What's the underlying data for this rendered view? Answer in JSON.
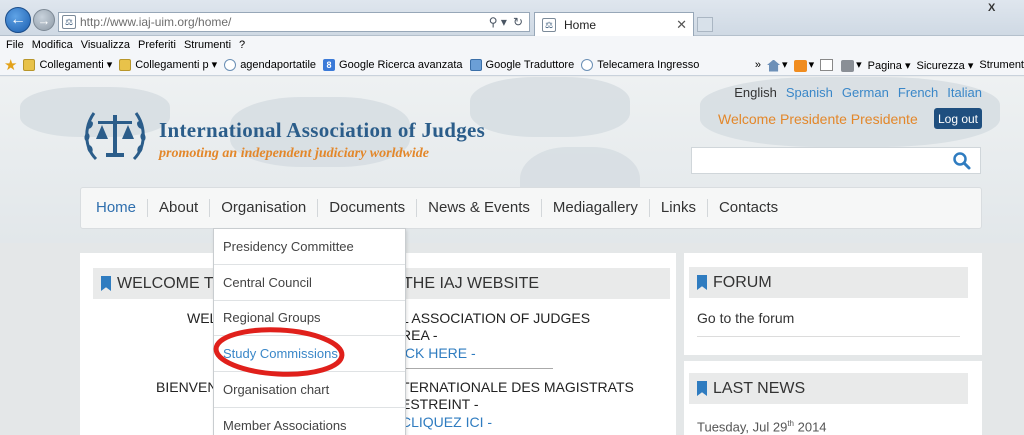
{
  "browser": {
    "url": "http://www.iaj-uim.org/home/",
    "tab_title": "Home",
    "tab_close": "✕",
    "window_close": "X",
    "menu": [
      "File",
      "Modifica",
      "Visualizza",
      "Preferiti",
      "Strumenti",
      "?"
    ],
    "favorites": [
      {
        "label": "Collegamenti ▾",
        "icon": "folder-icon"
      },
      {
        "label": "Collegamenti p ▾",
        "icon": "folder-icon"
      },
      {
        "label": "agendaportatile",
        "icon": "page-icon"
      },
      {
        "label": "Google Ricerca avanzata",
        "icon": "google-icon"
      },
      {
        "label": "Google Traduttore",
        "icon": "translate-icon"
      },
      {
        "label": "Telecamera Ingresso",
        "icon": "page-icon"
      }
    ],
    "chevron": "»",
    "commands": {
      "pagina": "Pagina ▾",
      "sicurezza": "Sicurezza ▾",
      "strumenti": "Strument"
    }
  },
  "site": {
    "title": "International Association of Judges",
    "tagline": "promoting an independent judiciary worldwide",
    "languages": [
      "English",
      "Spanish",
      "German",
      "French",
      "Italian"
    ],
    "active_language": "English",
    "welcome": "Welcome Presidente Presidente",
    "logout_label": "Log out",
    "search_placeholder": "",
    "brand_blue": "#2b5d8a",
    "brand_orange": "#e3872a",
    "nav": [
      "Home",
      "About",
      "Organisation",
      "Documents",
      "News & Events",
      "Mediagallery",
      "Links",
      "Contacts"
    ]
  },
  "dropdown": {
    "items": [
      "Presidency Committee",
      "Central Council",
      "Regional Groups",
      "Study Commissions",
      "Organisation chart",
      "Member Associations"
    ],
    "highlighted": "Study Commissions",
    "annotation_color": "#e0201b"
  },
  "welcome_panel": {
    "title_left": "WELCOME T",
    "title_right": "THE IAJ WEBSITE",
    "line1_left": "WEL",
    "line1_right": "L ASSOCIATION OF JUDGES",
    "line2_right": "REA -",
    "link1": "ICK HERE -",
    "line3_left": "BIENVEN",
    "line3_right": "TERNATIONALE DES MAGISTRATS",
    "line4_right": "ESTREINT -",
    "link2": "CLIQUEZ ICI -"
  },
  "forum": {
    "title": "FORUM",
    "link": "Go to the forum"
  },
  "news": {
    "title": "LAST NEWS",
    "date_main": "Tuesday, Jul 29",
    "date_sup": "th",
    "date_year": " 2014"
  }
}
